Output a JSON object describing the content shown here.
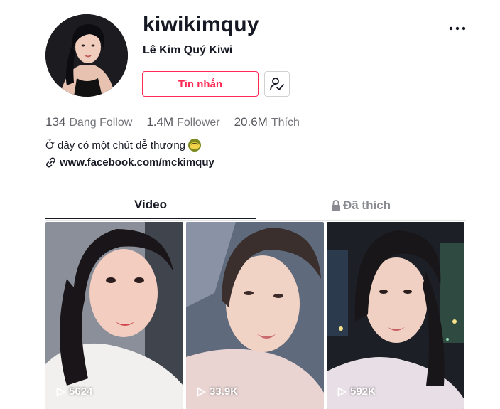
{
  "profile": {
    "username": "kiwikimquy",
    "nickname": "Lê Kim Quý Kiwi",
    "message_button": "Tin nhắn",
    "bio": "Ở đây có một chút dễ thương",
    "link": "www.facebook.com/mckimquy"
  },
  "stats": [
    {
      "value": "134",
      "label": "Đang Follow"
    },
    {
      "value": "1.4M",
      "label": "Follower"
    },
    {
      "value": "20.6M",
      "label": "Thích"
    }
  ],
  "tabs": [
    {
      "label": "Video",
      "active": true
    },
    {
      "label": "Đã thích",
      "active": false,
      "icon": "lock-icon"
    }
  ],
  "videos": [
    {
      "views": "5624"
    },
    {
      "views": "33.9K"
    },
    {
      "views": "592K"
    }
  ],
  "colors": {
    "accent": "#fe2c55",
    "text": "#161823",
    "muted": "#73747a"
  }
}
